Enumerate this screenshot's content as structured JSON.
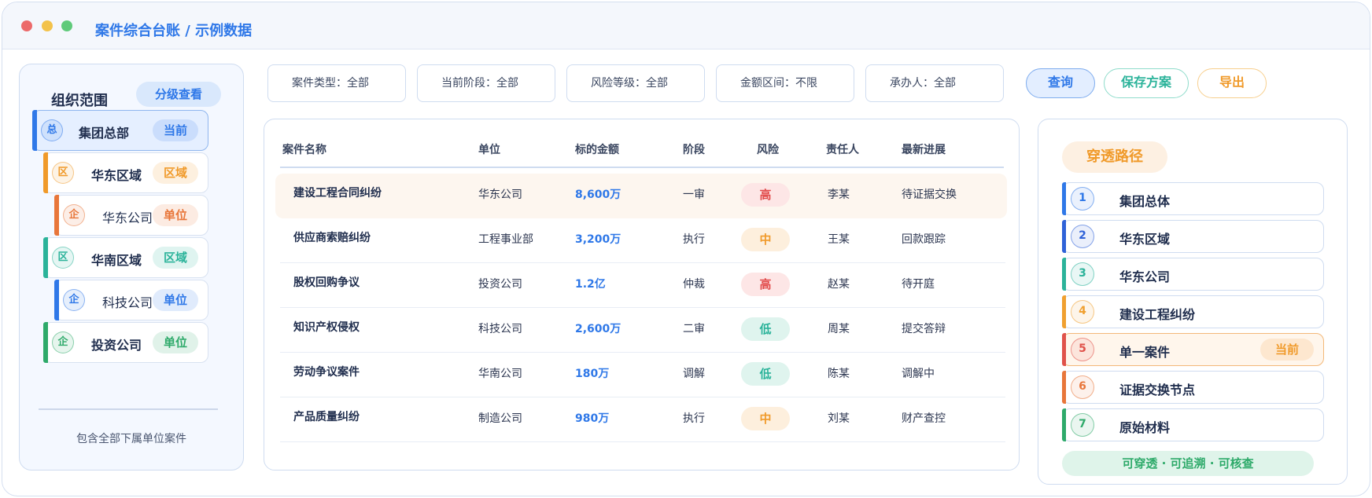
{
  "window": {
    "title": "案件综合台账 / 示例数据"
  },
  "org": {
    "title": "组织范围",
    "view_button": "分级查看",
    "items": [
      {
        "icon": "总",
        "name": "集团总部",
        "tag": "当前",
        "color": "#2f78e8"
      },
      {
        "icon": "区",
        "name": "华东区域",
        "tag": "区域",
        "color": "#f09a2a"
      },
      {
        "icon": "企",
        "name": "华东公司",
        "tag": "单位",
        "color": "#e8763a"
      },
      {
        "icon": "区",
        "name": "华南区域",
        "tag": "区域",
        "color": "#2bb39a"
      },
      {
        "icon": "企",
        "name": "科技公司",
        "tag": "单位",
        "color": "#2f78e8"
      },
      {
        "icon": "企",
        "name": "投资公司",
        "tag": "单位",
        "color": "#2eaa6a"
      }
    ],
    "note": "包含全部下属单位案件"
  },
  "filters": [
    "案件类型：全部",
    "当前阶段：全部",
    "风险等级：全部",
    "金额区间：不限",
    "承办人：全部"
  ],
  "actions": {
    "query": "查询",
    "save": "保存方案",
    "export": "导出"
  },
  "table": {
    "headers": [
      "案件名称",
      "单位",
      "标的金额",
      "阶段",
      "风险",
      "责任人",
      "最新进展"
    ],
    "rows": [
      {
        "name": "建设工程合同纠纷",
        "unit": "华东公司",
        "amount": "8,600万",
        "stage": "一审",
        "risk": "高",
        "level": "high",
        "owner": "李某",
        "progress": "待证据交换"
      },
      {
        "name": "供应商索赔纠纷",
        "unit": "工程事业部",
        "amount": "3,200万",
        "stage": "执行",
        "risk": "中",
        "level": "mid",
        "owner": "王某",
        "progress": "回款跟踪"
      },
      {
        "name": "股权回购争议",
        "unit": "投资公司",
        "amount": "1.2亿",
        "stage": "仲裁",
        "risk": "高",
        "level": "high",
        "owner": "赵某",
        "progress": "待开庭"
      },
      {
        "name": "知识产权侵权",
        "unit": "科技公司",
        "amount": "2,600万",
        "stage": "二审",
        "risk": "低",
        "level": "low",
        "owner": "周某",
        "progress": "提交答辩"
      },
      {
        "name": "劳动争议案件",
        "unit": "华南公司",
        "amount": "180万",
        "stage": "调解",
        "risk": "低",
        "level": "low",
        "owner": "陈某",
        "progress": "调解中"
      },
      {
        "name": "产品质量纠纷",
        "unit": "制造公司",
        "amount": "980万",
        "stage": "执行",
        "risk": "中",
        "level": "mid",
        "owner": "刘某",
        "progress": "财产查控"
      }
    ]
  },
  "path": {
    "title": "穿透路径",
    "steps": [
      {
        "num": "1",
        "label": "集团总体",
        "color": "#2f78e8"
      },
      {
        "num": "2",
        "label": "华东区域",
        "color": "#2f62d8"
      },
      {
        "num": "3",
        "label": "华东公司",
        "color": "#2bb39a"
      },
      {
        "num": "4",
        "label": "建设工程纠纷",
        "color": "#f0a030"
      },
      {
        "num": "5",
        "label": "单一案件",
        "color": "#e0524a",
        "current": "当前"
      },
      {
        "num": "6",
        "label": "证据交换节点",
        "color": "#e8763a"
      },
      {
        "num": "7",
        "label": "原始材料",
        "color": "#2eaa6a"
      }
    ],
    "footer": "可穿透 · 可追溯 · 可核查"
  }
}
